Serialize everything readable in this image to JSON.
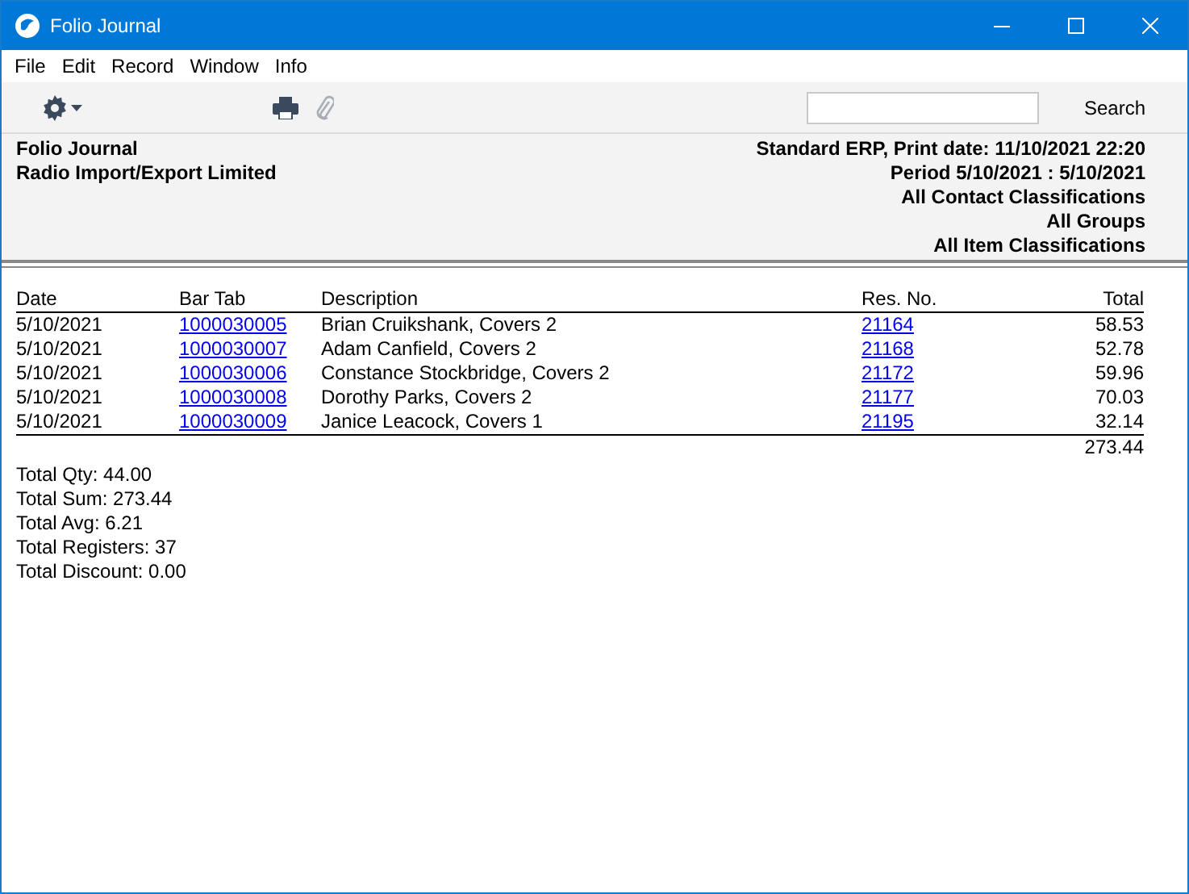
{
  "window": {
    "title": "Folio Journal"
  },
  "menu": [
    "File",
    "Edit",
    "Record",
    "Window",
    "Info"
  ],
  "toolbar": {
    "search_button": "Search"
  },
  "report_header": {
    "left": [
      "Folio Journal",
      "Radio Import/Export Limited"
    ],
    "right": [
      "Standard ERP, Print date: 11/10/2021 22:20",
      "Period  5/10/2021 : 5/10/2021",
      "All Contact Classifications",
      "All Groups",
      "All Item Classifications"
    ]
  },
  "table": {
    "columns": [
      "Date",
      "Bar Tab",
      "Description",
      "Res. No.",
      "Total"
    ],
    "rows": [
      {
        "date": "5/10/2021",
        "bar_tab": "1000030005",
        "description": "Brian Cruikshank, Covers 2",
        "res_no": "21164",
        "total": "58.53"
      },
      {
        "date": "5/10/2021",
        "bar_tab": "1000030007",
        "description": "Adam Canfield, Covers 2",
        "res_no": "21168",
        "total": "52.78"
      },
      {
        "date": "5/10/2021",
        "bar_tab": "1000030006",
        "description": "Constance Stockbridge, Covers 2",
        "res_no": "21172",
        "total": "59.96"
      },
      {
        "date": "5/10/2021",
        "bar_tab": "1000030008",
        "description": "Dorothy Parks, Covers 2",
        "res_no": "21177",
        "total": "70.03"
      },
      {
        "date": "5/10/2021",
        "bar_tab": "1000030009",
        "description": "Janice Leacock, Covers 1",
        "res_no": "21195",
        "total": "32.14"
      }
    ],
    "grand_total": "273.44"
  },
  "summary": [
    "Total Qty: 44.00",
    "Total Sum: 273.44",
    "Total Avg: 6.21",
    "Total Registers: 37",
    "Total Discount: 0.00"
  ]
}
